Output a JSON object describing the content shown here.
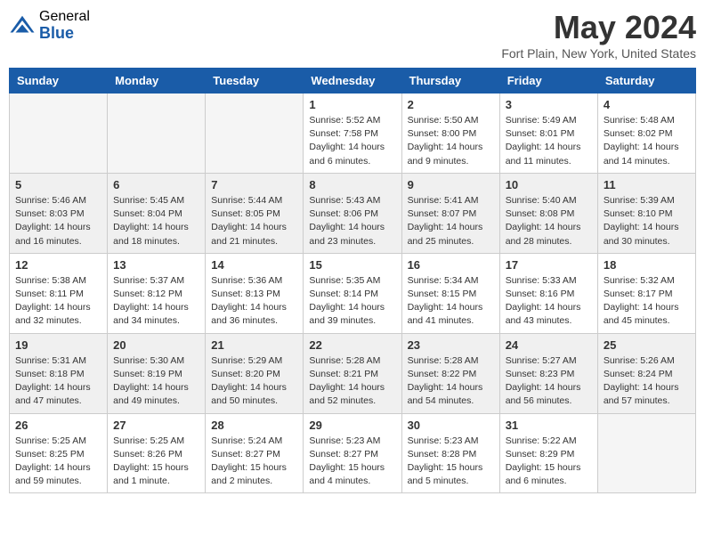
{
  "header": {
    "logo_general": "General",
    "logo_blue": "Blue",
    "month": "May 2024",
    "location": "Fort Plain, New York, United States"
  },
  "weekdays": [
    "Sunday",
    "Monday",
    "Tuesday",
    "Wednesday",
    "Thursday",
    "Friday",
    "Saturday"
  ],
  "weeks": [
    [
      {
        "day": "",
        "info": ""
      },
      {
        "day": "",
        "info": ""
      },
      {
        "day": "",
        "info": ""
      },
      {
        "day": "1",
        "info": "Sunrise: 5:52 AM\nSunset: 7:58 PM\nDaylight: 14 hours\nand 6 minutes."
      },
      {
        "day": "2",
        "info": "Sunrise: 5:50 AM\nSunset: 8:00 PM\nDaylight: 14 hours\nand 9 minutes."
      },
      {
        "day": "3",
        "info": "Sunrise: 5:49 AM\nSunset: 8:01 PM\nDaylight: 14 hours\nand 11 minutes."
      },
      {
        "day": "4",
        "info": "Sunrise: 5:48 AM\nSunset: 8:02 PM\nDaylight: 14 hours\nand 14 minutes."
      }
    ],
    [
      {
        "day": "5",
        "info": "Sunrise: 5:46 AM\nSunset: 8:03 PM\nDaylight: 14 hours\nand 16 minutes."
      },
      {
        "day": "6",
        "info": "Sunrise: 5:45 AM\nSunset: 8:04 PM\nDaylight: 14 hours\nand 18 minutes."
      },
      {
        "day": "7",
        "info": "Sunrise: 5:44 AM\nSunset: 8:05 PM\nDaylight: 14 hours\nand 21 minutes."
      },
      {
        "day": "8",
        "info": "Sunrise: 5:43 AM\nSunset: 8:06 PM\nDaylight: 14 hours\nand 23 minutes."
      },
      {
        "day": "9",
        "info": "Sunrise: 5:41 AM\nSunset: 8:07 PM\nDaylight: 14 hours\nand 25 minutes."
      },
      {
        "day": "10",
        "info": "Sunrise: 5:40 AM\nSunset: 8:08 PM\nDaylight: 14 hours\nand 28 minutes."
      },
      {
        "day": "11",
        "info": "Sunrise: 5:39 AM\nSunset: 8:10 PM\nDaylight: 14 hours\nand 30 minutes."
      }
    ],
    [
      {
        "day": "12",
        "info": "Sunrise: 5:38 AM\nSunset: 8:11 PM\nDaylight: 14 hours\nand 32 minutes."
      },
      {
        "day": "13",
        "info": "Sunrise: 5:37 AM\nSunset: 8:12 PM\nDaylight: 14 hours\nand 34 minutes."
      },
      {
        "day": "14",
        "info": "Sunrise: 5:36 AM\nSunset: 8:13 PM\nDaylight: 14 hours\nand 36 minutes."
      },
      {
        "day": "15",
        "info": "Sunrise: 5:35 AM\nSunset: 8:14 PM\nDaylight: 14 hours\nand 39 minutes."
      },
      {
        "day": "16",
        "info": "Sunrise: 5:34 AM\nSunset: 8:15 PM\nDaylight: 14 hours\nand 41 minutes."
      },
      {
        "day": "17",
        "info": "Sunrise: 5:33 AM\nSunset: 8:16 PM\nDaylight: 14 hours\nand 43 minutes."
      },
      {
        "day": "18",
        "info": "Sunrise: 5:32 AM\nSunset: 8:17 PM\nDaylight: 14 hours\nand 45 minutes."
      }
    ],
    [
      {
        "day": "19",
        "info": "Sunrise: 5:31 AM\nSunset: 8:18 PM\nDaylight: 14 hours\nand 47 minutes."
      },
      {
        "day": "20",
        "info": "Sunrise: 5:30 AM\nSunset: 8:19 PM\nDaylight: 14 hours\nand 49 minutes."
      },
      {
        "day": "21",
        "info": "Sunrise: 5:29 AM\nSunset: 8:20 PM\nDaylight: 14 hours\nand 50 minutes."
      },
      {
        "day": "22",
        "info": "Sunrise: 5:28 AM\nSunset: 8:21 PM\nDaylight: 14 hours\nand 52 minutes."
      },
      {
        "day": "23",
        "info": "Sunrise: 5:28 AM\nSunset: 8:22 PM\nDaylight: 14 hours\nand 54 minutes."
      },
      {
        "day": "24",
        "info": "Sunrise: 5:27 AM\nSunset: 8:23 PM\nDaylight: 14 hours\nand 56 minutes."
      },
      {
        "day": "25",
        "info": "Sunrise: 5:26 AM\nSunset: 8:24 PM\nDaylight: 14 hours\nand 57 minutes."
      }
    ],
    [
      {
        "day": "26",
        "info": "Sunrise: 5:25 AM\nSunset: 8:25 PM\nDaylight: 14 hours\nand 59 minutes."
      },
      {
        "day": "27",
        "info": "Sunrise: 5:25 AM\nSunset: 8:26 PM\nDaylight: 15 hours\nand 1 minute."
      },
      {
        "day": "28",
        "info": "Sunrise: 5:24 AM\nSunset: 8:27 PM\nDaylight: 15 hours\nand 2 minutes."
      },
      {
        "day": "29",
        "info": "Sunrise: 5:23 AM\nSunset: 8:27 PM\nDaylight: 15 hours\nand 4 minutes."
      },
      {
        "day": "30",
        "info": "Sunrise: 5:23 AM\nSunset: 8:28 PM\nDaylight: 15 hours\nand 5 minutes."
      },
      {
        "day": "31",
        "info": "Sunrise: 5:22 AM\nSunset: 8:29 PM\nDaylight: 15 hours\nand 6 minutes."
      },
      {
        "day": "",
        "info": ""
      }
    ]
  ]
}
